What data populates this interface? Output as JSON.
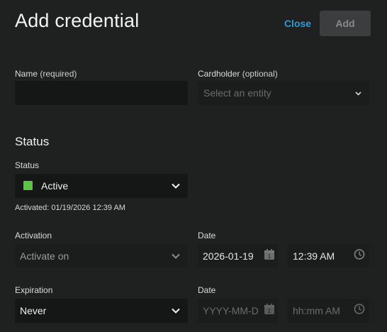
{
  "dialog": {
    "title": "Add credential",
    "close_label": "Close",
    "add_label": "Add"
  },
  "name_field": {
    "label": "Name",
    "label_suffix": "(required)",
    "value": ""
  },
  "cardholder_field": {
    "label": "Cardholder",
    "label_suffix": "(optional)",
    "placeholder": "Select an entity"
  },
  "status_section": {
    "title": "Status",
    "status_label": "Status",
    "status_value": "Active",
    "status_color": "#5bc447",
    "activated_note": "Activated: 01/19/2026 12:39 AM"
  },
  "activation": {
    "label": "Activation",
    "value": "Activate on",
    "date_label": "Date",
    "date_value": "2026-01-19",
    "time_value": "12:39 AM"
  },
  "expiration": {
    "label": "Expiration",
    "value": "Never",
    "date_label": "Date",
    "date_placeholder": "YYYY-MM-DI",
    "time_placeholder": "hh:mm AM"
  },
  "colors": {
    "accent": "#2d9bd9",
    "background": "#1f2020",
    "input_bg": "#151616"
  },
  "icons": [
    "chevron-down-icon",
    "calendar-icon",
    "clock-icon"
  ]
}
